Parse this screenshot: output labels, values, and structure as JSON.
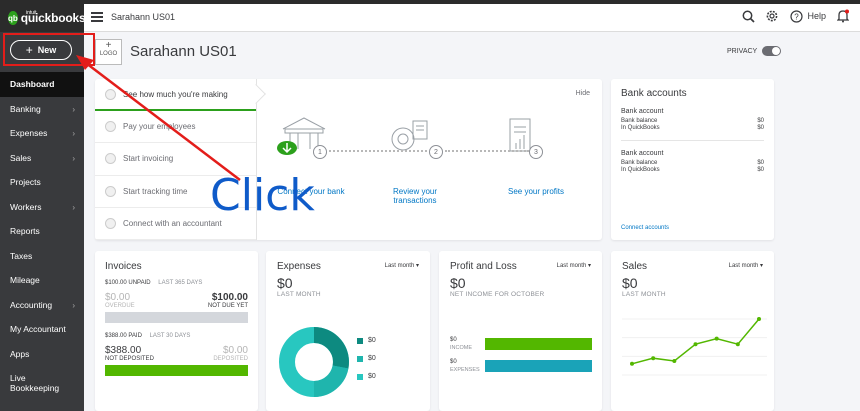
{
  "header": {
    "brand": "quickbooks",
    "brand_small": "intuit",
    "brand_badge": "qb",
    "company": "Sarahann US01",
    "help_label": "Help"
  },
  "sidebar": {
    "new_label": "New",
    "items": [
      {
        "label": "Dashboard",
        "active": true
      },
      {
        "label": "Banking",
        "chevron": true
      },
      {
        "label": "Expenses",
        "chevron": true
      },
      {
        "label": "Sales",
        "chevron": true
      },
      {
        "label": "Projects"
      },
      {
        "label": "Workers",
        "chevron": true
      },
      {
        "label": "Reports"
      },
      {
        "label": "Taxes"
      },
      {
        "label": "Mileage"
      },
      {
        "label": "Accounting",
        "chevron": true
      },
      {
        "label": "My Accountant"
      },
      {
        "label": "Apps"
      },
      {
        "label": "Live Bookkeeping"
      }
    ]
  },
  "company_header": {
    "logo_plus": "+",
    "logo_label": "LOGO",
    "name": "Sarahann US01",
    "privacy_label": "PRIVACY"
  },
  "setup": {
    "hide_label": "Hide",
    "items": [
      "See how much you're making",
      "Pay your employees",
      "Start invoicing",
      "Start tracking time",
      "Connect with an accountant"
    ],
    "steps": [
      {
        "num": "1",
        "label": "Connect your bank",
        "icon": "bank-icon"
      },
      {
        "num": "2",
        "label": "Review your transactions",
        "icon": "review-icon"
      },
      {
        "num": "3",
        "label": "See your profits",
        "icon": "receipt-icon"
      }
    ]
  },
  "bank_accounts": {
    "title": "Bank accounts",
    "accounts": [
      {
        "name": "Bank account",
        "bank_balance_label": "Bank balance",
        "bank_balance": "$0",
        "qb_label": "In QuickBooks",
        "qb_balance": "$0"
      },
      {
        "name": "Bank account",
        "bank_balance_label": "Bank balance",
        "bank_balance": "$0",
        "qb_label": "In QuickBooks",
        "qb_balance": "$0"
      }
    ],
    "connect_label": "Connect accounts"
  },
  "invoices": {
    "title": "Invoices",
    "unpaid_label": "$100.00 UNPAID",
    "unpaid_period": "LAST 365 DAYS",
    "overdue_amount": "$0.00",
    "overdue_label": "OVERDUE",
    "not_due_amount": "$100.00",
    "not_due_label": "NOT DUE YET",
    "paid_label": "$388.00 PAID",
    "paid_period": "LAST 30 DAYS",
    "not_deposited_amount": "$388.00",
    "not_deposited_label": "NOT DEPOSITED",
    "deposited_amount": "$0.00",
    "deposited_label": "DEPOSITED"
  },
  "expenses": {
    "title": "Expenses",
    "period": "Last month",
    "amount": "$0",
    "sub": "LAST MONTH",
    "legend": [
      {
        "value": "$0",
        "color": "#0d8a80"
      },
      {
        "value": "$0",
        "color": "#1fb5ad"
      },
      {
        "value": "$0",
        "color": "#28c7c0"
      }
    ]
  },
  "pnl": {
    "title": "Profit and Loss",
    "period": "Last month",
    "amount": "$0",
    "sub": "NET INCOME FOR OCTOBER",
    "income_amount": "$0",
    "income_label": "INCOME",
    "expenses_amount": "$0",
    "expenses_label": "EXPENSES",
    "colors": {
      "income": "#53b700",
      "expenses": "#1aa3b8"
    }
  },
  "sales": {
    "title": "Sales",
    "period": "Last month",
    "amount": "$0",
    "sub": "LAST MONTH",
    "trend": [
      0.2,
      0.3,
      0.25,
      0.55,
      0.65,
      0.55,
      1.0
    ],
    "color": "#53b700"
  },
  "annotation": {
    "text": "Click",
    "color": "#e31d1a"
  }
}
